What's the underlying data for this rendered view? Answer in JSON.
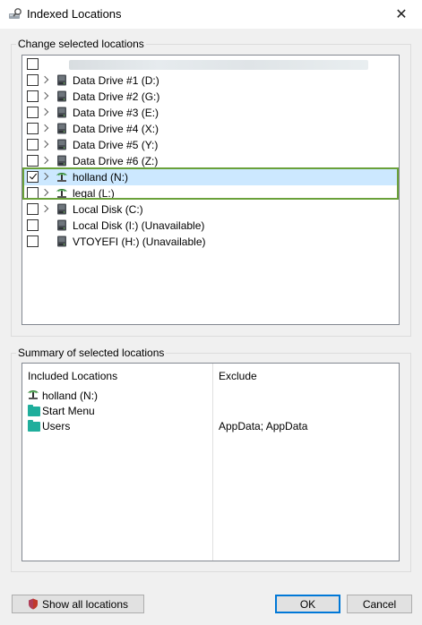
{
  "window": {
    "title": "Indexed Locations",
    "close_glyph": "✕"
  },
  "change_group": {
    "label": "Change selected locations",
    "items": [
      {
        "label": "",
        "checked": false,
        "expandable": false,
        "icon": "blurred",
        "selected": false
      },
      {
        "label": "Data Drive #1 (D:)",
        "checked": false,
        "expandable": true,
        "icon": "drive-icon",
        "selected": false
      },
      {
        "label": "Data Drive #2 (G:)",
        "checked": false,
        "expandable": true,
        "icon": "drive-icon",
        "selected": false
      },
      {
        "label": "Data Drive #3 (E:)",
        "checked": false,
        "expandable": true,
        "icon": "drive-icon",
        "selected": false
      },
      {
        "label": "Data Drive #4 (X:)",
        "checked": false,
        "expandable": true,
        "icon": "drive-icon",
        "selected": false
      },
      {
        "label": "Data Drive #5 (Y:)",
        "checked": false,
        "expandable": true,
        "icon": "drive-icon",
        "selected": false
      },
      {
        "label": "Data Drive #6 (Z:)",
        "checked": false,
        "expandable": true,
        "icon": "drive-icon",
        "selected": false
      },
      {
        "label": "holland (N:)",
        "checked": true,
        "expandable": true,
        "icon": "network-drive-icon",
        "selected": true
      },
      {
        "label": "legal (L:)",
        "checked": false,
        "expandable": true,
        "icon": "network-drive-icon",
        "selected": false
      },
      {
        "label": "Local Disk (C:)",
        "checked": false,
        "expandable": true,
        "icon": "drive-icon",
        "selected": false
      },
      {
        "label": "Local Disk (I:) (Unavailable)",
        "checked": false,
        "expandable": false,
        "icon": "drive-icon",
        "selected": false
      },
      {
        "label": "VTOYEFI (H:) (Unavailable)",
        "checked": false,
        "expandable": false,
        "icon": "drive-icon",
        "selected": false
      }
    ]
  },
  "summary_group": {
    "label": "Summary of selected locations",
    "col_included": "Included Locations",
    "col_exclude": "Exclude",
    "rows": [
      {
        "location": "holland (N:)",
        "icon": "network-drive-icon",
        "exclude": ""
      },
      {
        "location": "Start Menu",
        "icon": "folder-icon",
        "exclude": ""
      },
      {
        "location": "Users",
        "icon": "folder-icon",
        "exclude": "AppData; AppData"
      }
    ]
  },
  "buttons": {
    "show_all": "Show all locations",
    "ok": "OK",
    "cancel": "Cancel"
  },
  "colors": {
    "accent": "#0078d7",
    "highlight_border": "#6aa13a",
    "selection": "#cce8ff",
    "folder": "#1fae9c"
  }
}
